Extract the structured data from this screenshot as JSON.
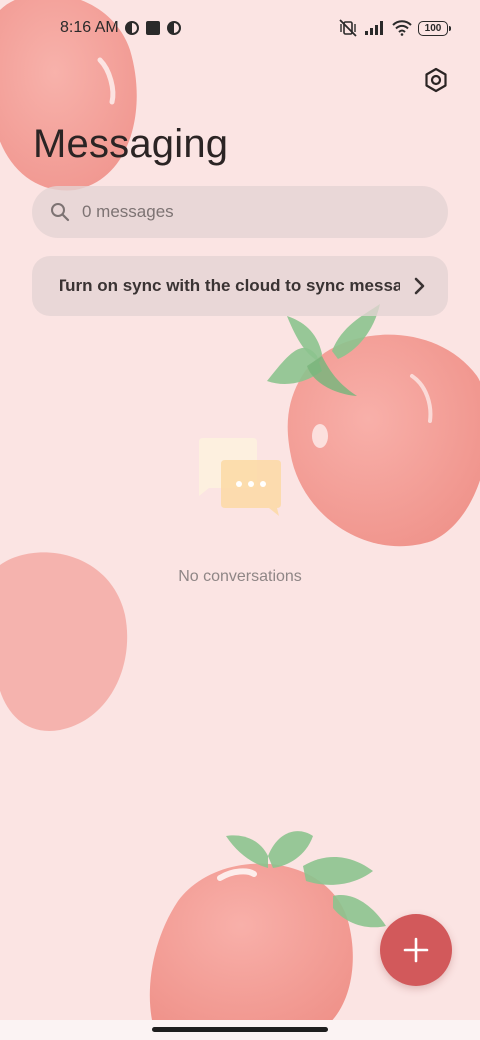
{
  "status_bar": {
    "time": "8:16 AM",
    "battery": "100",
    "icons": [
      "circle-half-icon",
      "square-app-icon",
      "circle-half-icon",
      "vibrate-off-icon",
      "signal-icon",
      "wifi-icon",
      "battery-icon"
    ]
  },
  "header": {
    "title": "Messaging",
    "settings_icon": "settings-hexagon-icon"
  },
  "search": {
    "placeholder": "0 messages",
    "value": ""
  },
  "sync_banner": {
    "text": "Turn on sync with the cloud to sync messages"
  },
  "empty_state": {
    "icon": "chat-bubbles-icon",
    "text": "No conversations"
  },
  "fab": {
    "icon": "plus-icon",
    "color": "#d2595b"
  },
  "theme": {
    "background": "#fbe4e3",
    "accent": "#d2595b",
    "wallpaper": "strawberries"
  }
}
